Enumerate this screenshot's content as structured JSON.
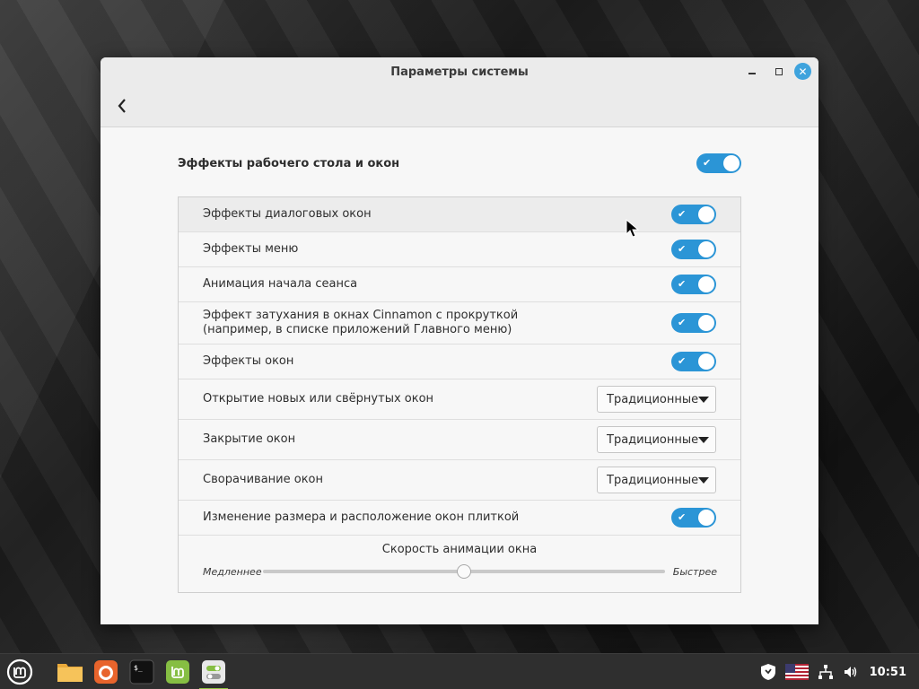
{
  "window": {
    "title": "Параметры системы",
    "close_glyph": "✕"
  },
  "master": {
    "label": "Эффекты рабочего стола и окон",
    "enabled": true
  },
  "rows": [
    {
      "label": "Эффекты диалоговых окон",
      "type": "switch",
      "enabled": true
    },
    {
      "label": "Эффекты меню",
      "type": "switch",
      "enabled": true
    },
    {
      "label": "Анимация начала сеанса",
      "type": "switch",
      "enabled": true
    },
    {
      "label": "Эффект затухания в окнах Cinnamon с прокруткой (например, в списке приложений Главного меню)",
      "type": "switch",
      "enabled": true
    },
    {
      "label": "Эффекты окон",
      "type": "switch",
      "enabled": true
    },
    {
      "label": "Открытие новых или свёрнутых окон",
      "type": "combo",
      "value": "Традиционные"
    },
    {
      "label": "Закрытие окон",
      "type": "combo",
      "value": "Традиционные"
    },
    {
      "label": "Сворачивание окон",
      "type": "combo",
      "value": "Традиционные"
    },
    {
      "label": "Изменение размера и расположение окон плиткой",
      "type": "switch",
      "enabled": true
    }
  ],
  "speed": {
    "caption": "Скорость анимации окна",
    "slow_label": "Медленнее",
    "fast_label": "Быстрее",
    "value": 0.5
  },
  "taskbar": {
    "apps": [
      "menu-icon",
      "files-icon",
      "firefox-icon",
      "terminal-icon",
      "mintupdate-icon",
      "settings-icon"
    ],
    "clock": "10:51"
  },
  "colors": {
    "accent": "#2b95d6",
    "close_button": "#3ea3dd",
    "active_indicator": "#8fc43f"
  }
}
